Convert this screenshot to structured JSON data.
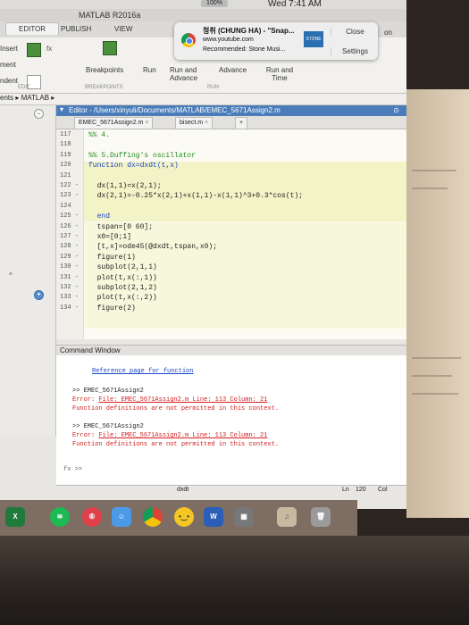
{
  "menubar": {
    "battery": "100%",
    "time": "Wed 7:41 AM"
  },
  "window": {
    "title": "MATLAB R2016a"
  },
  "tabs": {
    "editor": "EDITOR",
    "publish": "PUBLISH",
    "view": "VIEW"
  },
  "ribbon": {
    "insert": "Insert",
    "ment": "ment",
    "ndent": "ndent",
    "breakpoints": "Breakpoints",
    "run": "Run",
    "run_and_advance": "Run and Advance",
    "advance": "Advance",
    "run_and_time": "Run and Time",
    "section_edit": "EDIT",
    "section_breakpoints": "BREAKPOINTS",
    "section_run": "RUN"
  },
  "notification": {
    "title": "청취 (CHUNG HA) - \"Snap...",
    "url": "www.youtube.com",
    "subtitle": "Recommended: Stone Musi...",
    "close": "Close",
    "settings": "Settings",
    "thumb_label": "STONE",
    "side_label": "on"
  },
  "path": {
    "crumb1": "ents",
    "crumb2": "MATLAB"
  },
  "editor": {
    "header": "Editor - /Users/xinyuli/Documents/MATLAB/EMEC_5671Assign2.m",
    "tab1": "EMEC_5671Assign2.m",
    "tab2": "bisect.m",
    "lines": [
      {
        "n": "117",
        "t": "%% 4."
      },
      {
        "n": "118",
        "t": ""
      },
      {
        "n": "119",
        "t": "%% 5.Duffing's oscillator"
      },
      {
        "n": "120",
        "t": "function dx=dxdt(t,x)"
      },
      {
        "n": "121",
        "t": ""
      },
      {
        "n": "122 -",
        "t": "  dx(1,1)=x(2,1);"
      },
      {
        "n": "123 -",
        "t": "  dx(2,1)=-0.25*x(2,1)+x(1,1)-x(1,1)^3+0.3*cos(t);"
      },
      {
        "n": "124",
        "t": ""
      },
      {
        "n": "125 -",
        "t": "  end"
      },
      {
        "n": "126 -",
        "t": "  tspan=[0 60];"
      },
      {
        "n": "127 -",
        "t": "  x0=[0;1]"
      },
      {
        "n": "128 -",
        "t": "  [t,x]=ode45(@dxdt,tspan,x0);"
      },
      {
        "n": "129 -",
        "t": "  figure(1)"
      },
      {
        "n": "130 -",
        "t": "  subplot(2,1,1)"
      },
      {
        "n": "131 -",
        "t": "  plot(t,x(:,1))"
      },
      {
        "n": "132 -",
        "t": "  subplot(2,1,2)"
      },
      {
        "n": "133 -",
        "t": "  plot(t,x(:,2))"
      },
      {
        "n": "134 -",
        "t": "  figure(2)"
      }
    ]
  },
  "command_window": {
    "title": "Command Window",
    "ref_link": "Reference page for function",
    "cmd1": ">> EMEC_5671Assign2",
    "err1_prefix": "Error: ",
    "err1_link": "File: EMEC_5671Assign2.m Line: 113 Column: 21",
    "err1_msg": "Function definitions are not permitted in this context.",
    "cmd2": ">> EMEC_5671Assign2",
    "err2_prefix": "Error: ",
    "err2_link": "File: EMEC_5671Assign2.m Line: 113 Column: 21",
    "err2_msg": "Function definitions are not permitted in this context.",
    "prompt": "fx >>"
  },
  "status": {
    "func": "dxdt",
    "ln_label": "Ln",
    "ln_value": "120",
    "col_label": "Col"
  }
}
